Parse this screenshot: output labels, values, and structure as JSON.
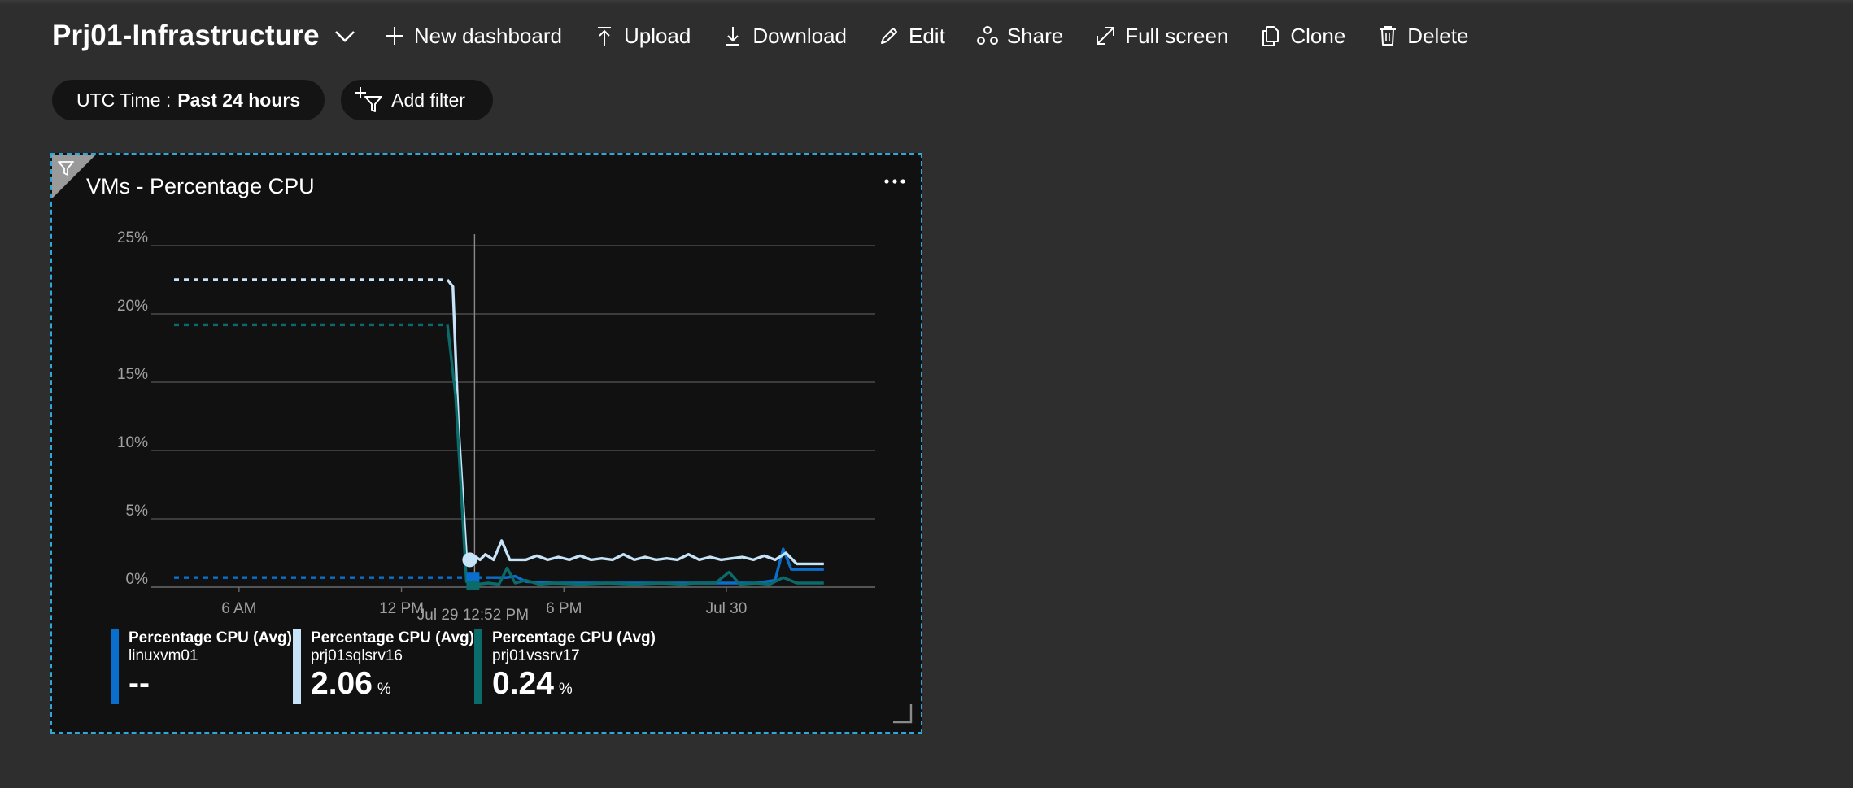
{
  "dashboard": {
    "title": "Prj01-Infrastructure"
  },
  "toolbar": {
    "new_dashboard": "New dashboard",
    "upload": "Upload",
    "download": "Download",
    "edit": "Edit",
    "share": "Share",
    "full_screen": "Full screen",
    "clone": "Clone",
    "delete": "Delete"
  },
  "filters": {
    "time_label": "UTC Time :",
    "time_value": "Past 24 hours",
    "add_filter": "Add filter"
  },
  "tile": {
    "title": "VMs - Percentage CPU",
    "menu_icon": "more-ellipsis-icon",
    "corner_icon": "filter-icon"
  },
  "colors": {
    "accent": "#2fa8d8",
    "series_linuxvm01": "#0a6fcc",
    "series_prj01sqlsrv16": "#c6e3f7",
    "series_prj01vssrv17": "#0b6b6b"
  },
  "chart_data": {
    "type": "line",
    "ylim": [
      0,
      25
    ],
    "yticks": [
      "0%",
      "5%",
      "10%",
      "15%",
      "20%",
      "25%"
    ],
    "xticks": [
      "6 AM",
      "12 PM",
      "6 PM",
      "Jul 30"
    ],
    "cursor_label": "Jul 29 12:52 PM",
    "grid": true,
    "series": [
      {
        "name": "linuxvm01",
        "color": "#0a6fcc",
        "dashed_until": 11.7,
        "points": [
          [
            0,
            0.7
          ],
          [
            11.7,
            0.7
          ],
          [
            12.3,
            0.7
          ],
          [
            12.6,
            0.8
          ],
          [
            13,
            0.4
          ],
          [
            14,
            0.3
          ],
          [
            15,
            0.3
          ],
          [
            16,
            0.3
          ],
          [
            17,
            0.3
          ],
          [
            18,
            0.3
          ],
          [
            19,
            0.3
          ],
          [
            20,
            0.3
          ],
          [
            21,
            0.3
          ],
          [
            21.5,
            0.3
          ],
          [
            22.2,
            0.5
          ],
          [
            22.5,
            2.8
          ],
          [
            22.8,
            1.3
          ],
          [
            23.4,
            1.3
          ],
          [
            24,
            1.3
          ]
        ]
      },
      {
        "name": "prj01sqlsrv16",
        "color": "#c6e3f7",
        "dashed_until": 10.1,
        "points": [
          [
            0,
            22.5
          ],
          [
            10.1,
            22.5
          ],
          [
            10.3,
            22.0
          ],
          [
            10.5,
            12.0
          ],
          [
            10.8,
            2.2
          ],
          [
            11.0,
            2.4
          ],
          [
            11.3,
            2.0
          ],
          [
            11.5,
            2.4
          ],
          [
            11.8,
            2.0
          ],
          [
            12.1,
            3.4
          ],
          [
            12.4,
            2.0
          ],
          [
            13,
            2.0
          ],
          [
            13.4,
            2.3
          ],
          [
            13.8,
            2.0
          ],
          [
            14.2,
            2.2
          ],
          [
            14.6,
            2.0
          ],
          [
            15,
            2.3
          ],
          [
            15.4,
            2.0
          ],
          [
            15.8,
            2.1
          ],
          [
            16.2,
            2.0
          ],
          [
            16.6,
            2.4
          ],
          [
            17,
            2.0
          ],
          [
            17.4,
            2.2
          ],
          [
            17.8,
            2.0
          ],
          [
            18.2,
            2.1
          ],
          [
            18.6,
            2.0
          ],
          [
            19,
            2.4
          ],
          [
            19.4,
            2.0
          ],
          [
            19.8,
            2.2
          ],
          [
            20.2,
            2.0
          ],
          [
            20.6,
            2.1
          ],
          [
            21,
            2.2
          ],
          [
            21.4,
            2.0
          ],
          [
            21.8,
            2.3
          ],
          [
            22.2,
            2.0
          ],
          [
            22.6,
            2.5
          ],
          [
            23,
            1.7
          ],
          [
            23.4,
            1.7
          ],
          [
            24,
            1.7
          ]
        ]
      },
      {
        "name": "prj01vssrv17",
        "color": "#0b6b6b",
        "dashed_until": 10.1,
        "points": [
          [
            0,
            19.2
          ],
          [
            10.1,
            19.2
          ],
          [
            10.4,
            14.0
          ],
          [
            10.8,
            0.4
          ],
          [
            11.2,
            0.2
          ],
          [
            11.6,
            0.3
          ],
          [
            12.0,
            0.2
          ],
          [
            12.3,
            1.4
          ],
          [
            12.6,
            0.3
          ],
          [
            13,
            0.5
          ],
          [
            13.5,
            0.2
          ],
          [
            14,
            0.3
          ],
          [
            15,
            0.2
          ],
          [
            16,
            0.3
          ],
          [
            17,
            0.2
          ],
          [
            18,
            0.3
          ],
          [
            18.8,
            0.2
          ],
          [
            19.2,
            0.3
          ],
          [
            20,
            0.3
          ],
          [
            20.5,
            1.1
          ],
          [
            20.9,
            0.2
          ],
          [
            21.5,
            0.3
          ],
          [
            22,
            0.2
          ],
          [
            22.5,
            0.7
          ],
          [
            23,
            0.3
          ],
          [
            24,
            0.3
          ]
        ]
      }
    ],
    "cursor_x": 11.0
  },
  "legend": [
    {
      "metric": "Percentage CPU (Avg)",
      "resource": "linuxvm01",
      "value": "--",
      "unit": "",
      "color": "#0a6fcc"
    },
    {
      "metric": "Percentage CPU (Avg)",
      "resource": "prj01sqlsrv16",
      "value": "2.06",
      "unit": "%",
      "color": "#c6e3f7"
    },
    {
      "metric": "Percentage CPU (Avg)",
      "resource": "prj01vssrv17",
      "value": "0.24",
      "unit": "%",
      "color": "#0b6b6b"
    }
  ]
}
